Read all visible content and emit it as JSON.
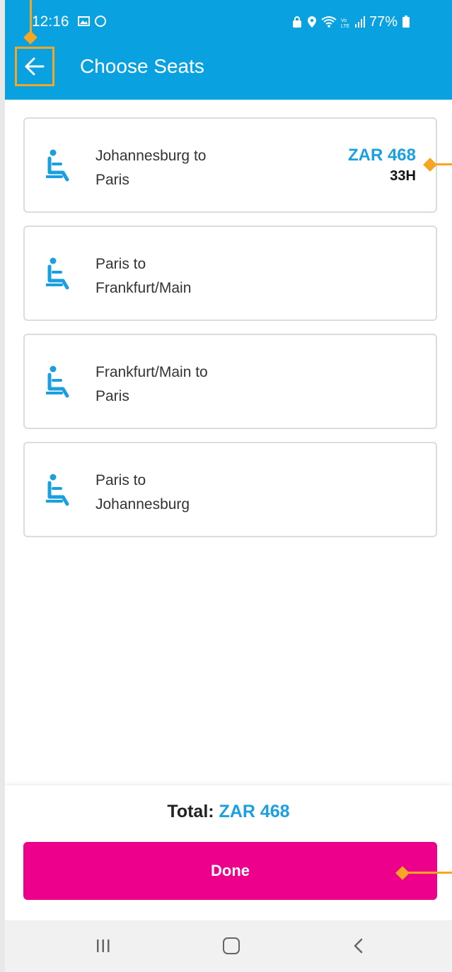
{
  "status_bar": {
    "time": "12:16",
    "battery": "77%"
  },
  "header": {
    "title": "Choose Seats",
    "back_icon": "arrow-left-icon"
  },
  "segments": [
    {
      "route_line1": "Johannesburg to",
      "route_line2": "Paris",
      "price": "ZAR 468",
      "seat": "33H"
    },
    {
      "route_line1": "Paris to",
      "route_line2": "Frankfurt/Main",
      "price": "",
      "seat": ""
    },
    {
      "route_line1": "Frankfurt/Main to",
      "route_line2": "Paris",
      "price": "",
      "seat": ""
    },
    {
      "route_line1": "Paris to",
      "route_line2": "Johannesburg",
      "price": "",
      "seat": ""
    }
  ],
  "footer": {
    "total_label": "Total:",
    "total_value": "ZAR 468",
    "done_label": "Done"
  },
  "colors": {
    "header": "#0aa1e0",
    "accent": "#1aa0e0",
    "done_button": "#ec008c",
    "annotation": "#f5a623"
  }
}
